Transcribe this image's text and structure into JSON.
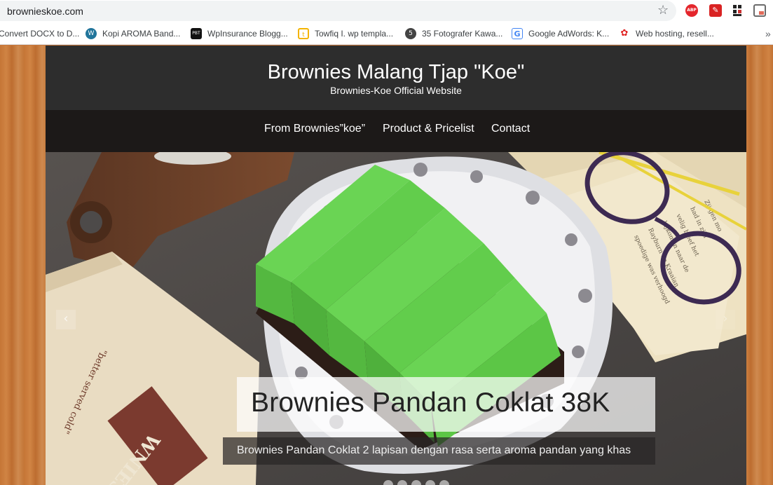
{
  "browser": {
    "url": "brownieskoe.com",
    "bookmarks": [
      {
        "label": "Convert DOCX to D...",
        "icon": "document-icon"
      },
      {
        "label": "Kopi AROMA Band...",
        "icon": "wordpress-icon",
        "glyph": "W"
      },
      {
        "label": "WpInsurance Blogg...",
        "icon": "pbt-icon",
        "glyph": "PBT"
      },
      {
        "label": "Towfiq I. wp templa...",
        "icon": "towfiq-icon",
        "glyph": "t"
      },
      {
        "label": "35 Fotografer Kawa...",
        "icon": "500px-icon",
        "glyph": "5"
      },
      {
        "label": "Google AdWords: K...",
        "icon": "google-icon",
        "glyph": "G"
      },
      {
        "label": "Web hosting, resell...",
        "icon": "hosting-icon",
        "glyph": "✿"
      }
    ],
    "extensions": {
      "abp": "ABP",
      "pdf": "✎"
    },
    "more": "»"
  },
  "site": {
    "title": "Brownies Malang Tjap \"Koe\"",
    "description": "Brownies-Koe Official Website",
    "nav": [
      "From Brownies”koe”",
      "Product & Pricelist",
      "Contact"
    ]
  },
  "slider": {
    "caption_title": "Brownies Pandan Coklat 38K",
    "caption_description": "Brownies Pandan Coklat 2 lapisan dengan rasa serta aroma pandan yang khas",
    "prev": "‹",
    "next": "›",
    "slide_count": 5
  },
  "colors": {
    "header": "#2d2d2d",
    "nav": "#1c1918",
    "cake_green": "#5fc94a",
    "wood": "#c57536"
  }
}
